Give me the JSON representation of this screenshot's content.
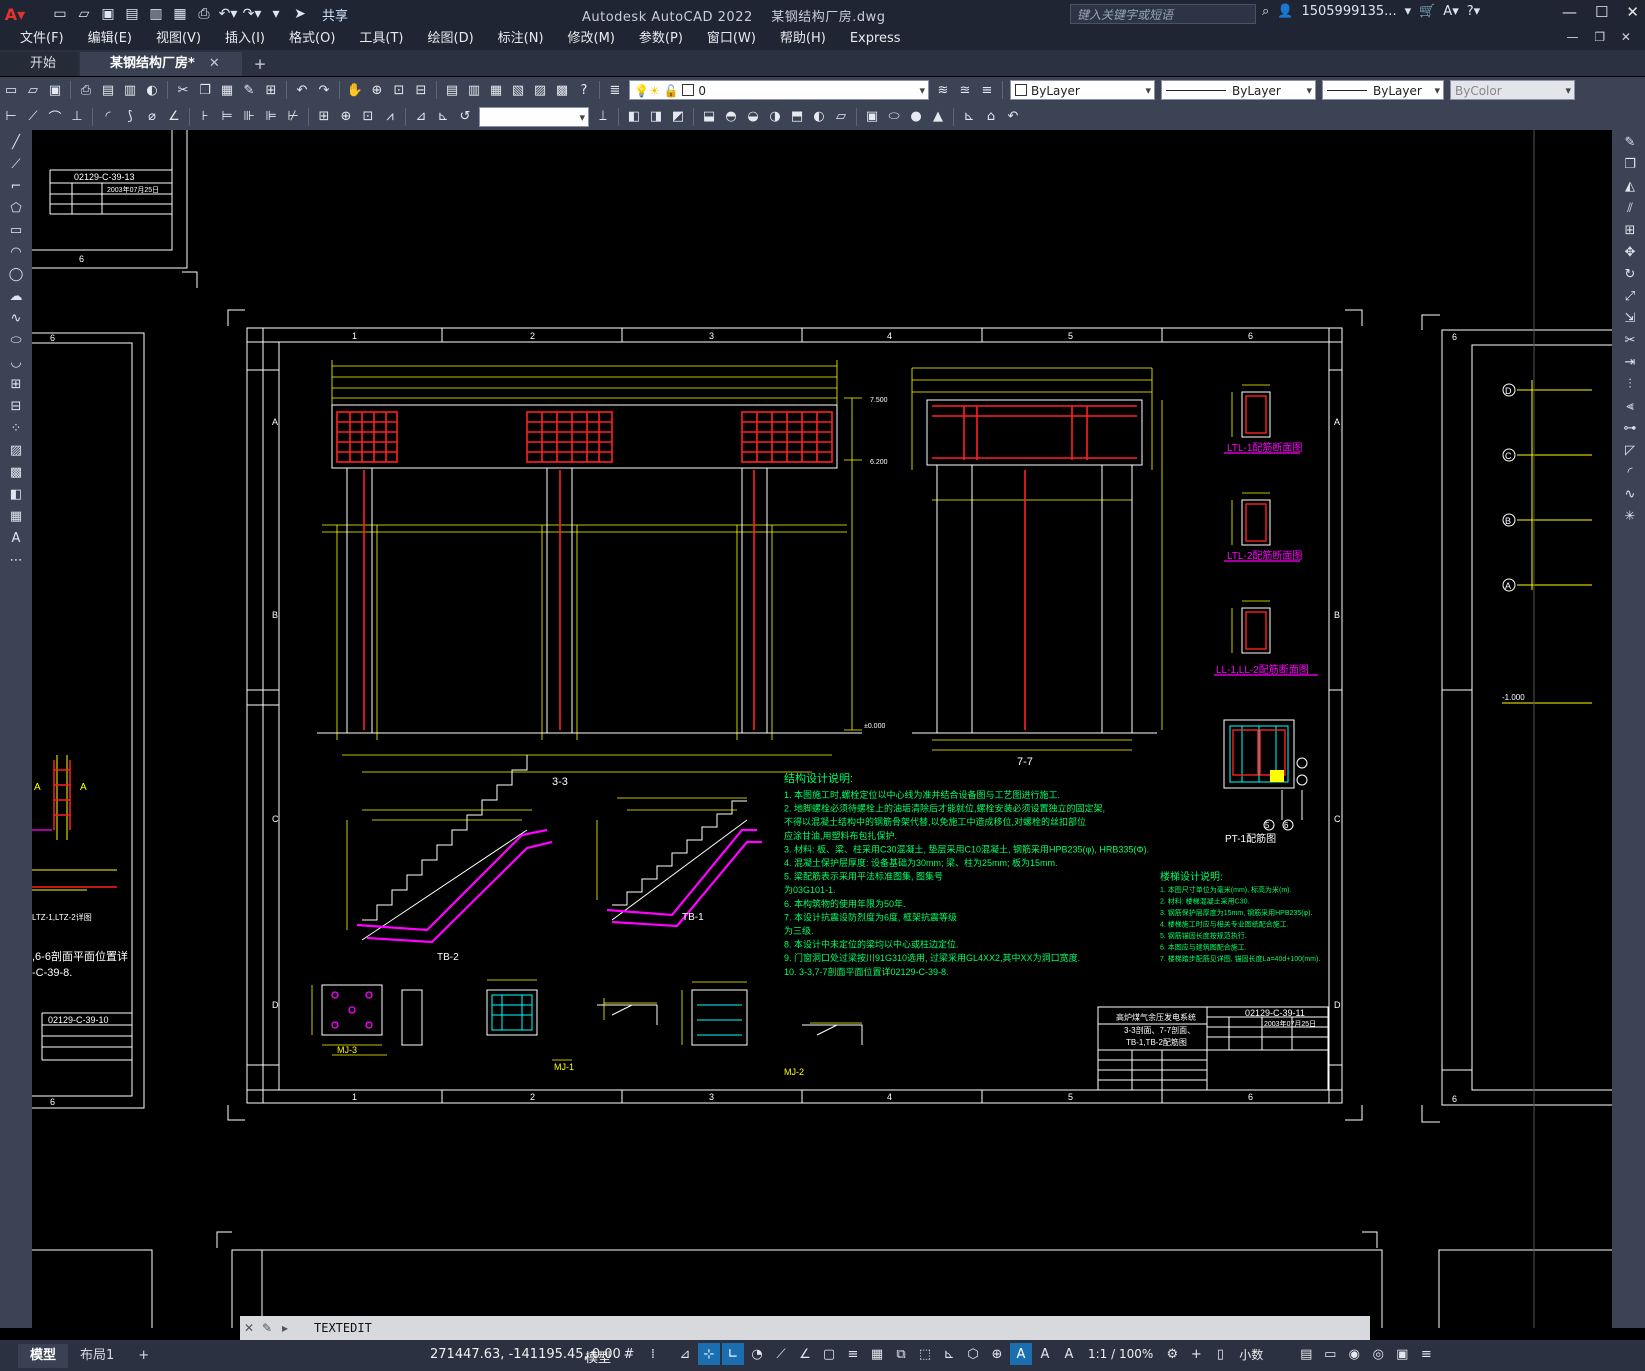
{
  "app": {
    "title": "Autodesk AutoCAD 2022",
    "filename": "某钢结构厂房.dwg",
    "share_label": "共享"
  },
  "search": {
    "placeholder": "键入关键字或短语"
  },
  "user": {
    "name": "1505999135..."
  },
  "menu": [
    "文件(F)",
    "编辑(E)",
    "视图(V)",
    "插入(I)",
    "格式(O)",
    "工具(T)",
    "绘图(D)",
    "标注(N)",
    "修改(M)",
    "参数(P)",
    "窗口(W)",
    "帮助(H)",
    "Express"
  ],
  "tabs": {
    "start": "开始",
    "active": "某钢结构厂房*"
  },
  "layer": {
    "current": "0"
  },
  "properties": {
    "color": "ByLayer",
    "linetype": "ByLayer",
    "lineweight": "ByLayer",
    "plotstyle": "ByColor"
  },
  "drawing": {
    "title_block": {
      "drawing_no": "02129-C-39-11",
      "drawing_no_left": "02129-C-39-10",
      "drawing_no_topleft": "02129-C-39-13",
      "date": "2003年07月25日",
      "project": "高炉煤气余压发电系统",
      "contents1": "3-3剖面、7-7剖面、",
      "contents2": "TB-1,TB-2配筋图"
    },
    "section_labels": {
      "s33": "3-3",
      "s77": "7-7",
      "tb1": "TB-1",
      "tb2": "TB-2",
      "mj1": "MJ-1",
      "mj2": "MJ-2",
      "mj3": "MJ-3",
      "pt1": "PT-1配筋图"
    },
    "beam_sections": [
      "LTL-1配筋断面图",
      "LTL-2配筋断面图",
      "LL-1,LL-2配筋断面图"
    ],
    "notes_title": "结构设计说明:",
    "notes": [
      "1. 本图施工时,螺栓定位以中心线为准并结合设备图与工艺图进行施工.",
      "2. 地脚螺栓必须待螺栓上的油垢清除后才能就位,螺栓安装必须设置独立的固定架,",
      "   不得以混凝土结构中的钢筋骨架代替,以免施工中造成移位,对螺栓的丝扣部位",
      "   应涂甘油,用塑料布包扎保护.",
      "3. 材料: 板、梁、柱采用C30混凝土, 垫层采用C10混凝土, 钢筋采用HPB235(φ), HRB335(Φ).",
      "4. 混凝土保护层厚度: 设备基础为30mm; 梁、柱为25mm; 板为15mm.",
      "5. 梁配筋表示采用平法标准图集, 图集号",
      "为03G101-1.",
      "6. 本构筑物的使用年限为50年.",
      "7. 本设计抗震设防烈度为6度, 框架抗震等级",
      "为三级.",
      "8. 本设计中未定位的梁均以中心或柱边定位.",
      "9. 门窗洞口处过梁按川91G310选用, 过梁采用GL4XX2,其中XX为洞口宽度.",
      "10. 3-3,7-7剖面平面位置详02129-C-39-8."
    ],
    "notes2_title": "楼梯设计说明:",
    "notes2": [
      "1. 本图尺寸单位为毫米(mm), 标高为米(m).",
      "2. 材料: 楼梯混凝土采用C30.",
      "3. 钢筋保护层厚度为15mm, 钢筋采用HPB235(φ).",
      "4. 楼梯施工时应与相关专业图纸配合施工.",
      "5. 钢筋锚固长度按规范执行.",
      "6. 本图应与建筑图配合施工.",
      "7. 楼梯踏步配筋见详图, 锚固长度La=40d+100(mm)."
    ],
    "left_note": [
      ",6-6剖面平面位置详",
      "-C-39-8."
    ],
    "left_labels": [
      "LTZ-1,LTZ-2详图"
    ],
    "grid_cols": [
      "1",
      "2",
      "3",
      "4",
      "5",
      "6"
    ],
    "grid_rows": [
      "A",
      "B",
      "C",
      "D"
    ],
    "axis_bubbles": [
      "D",
      "C",
      "B",
      "A"
    ],
    "ref_bubbles": [
      "5",
      "6"
    ],
    "elev": [
      "7.500",
      "6.200",
      "±0.000",
      "-1.000"
    ]
  },
  "command": {
    "text": "TEXTEDIT"
  },
  "layouts": {
    "model": "模型",
    "layout1": "布局1",
    "add": "+"
  },
  "status": {
    "coords": "271447.63, -141195.45, 0.00",
    "space": "模型",
    "scale": "1:1 / 100%",
    "units": "小数"
  }
}
